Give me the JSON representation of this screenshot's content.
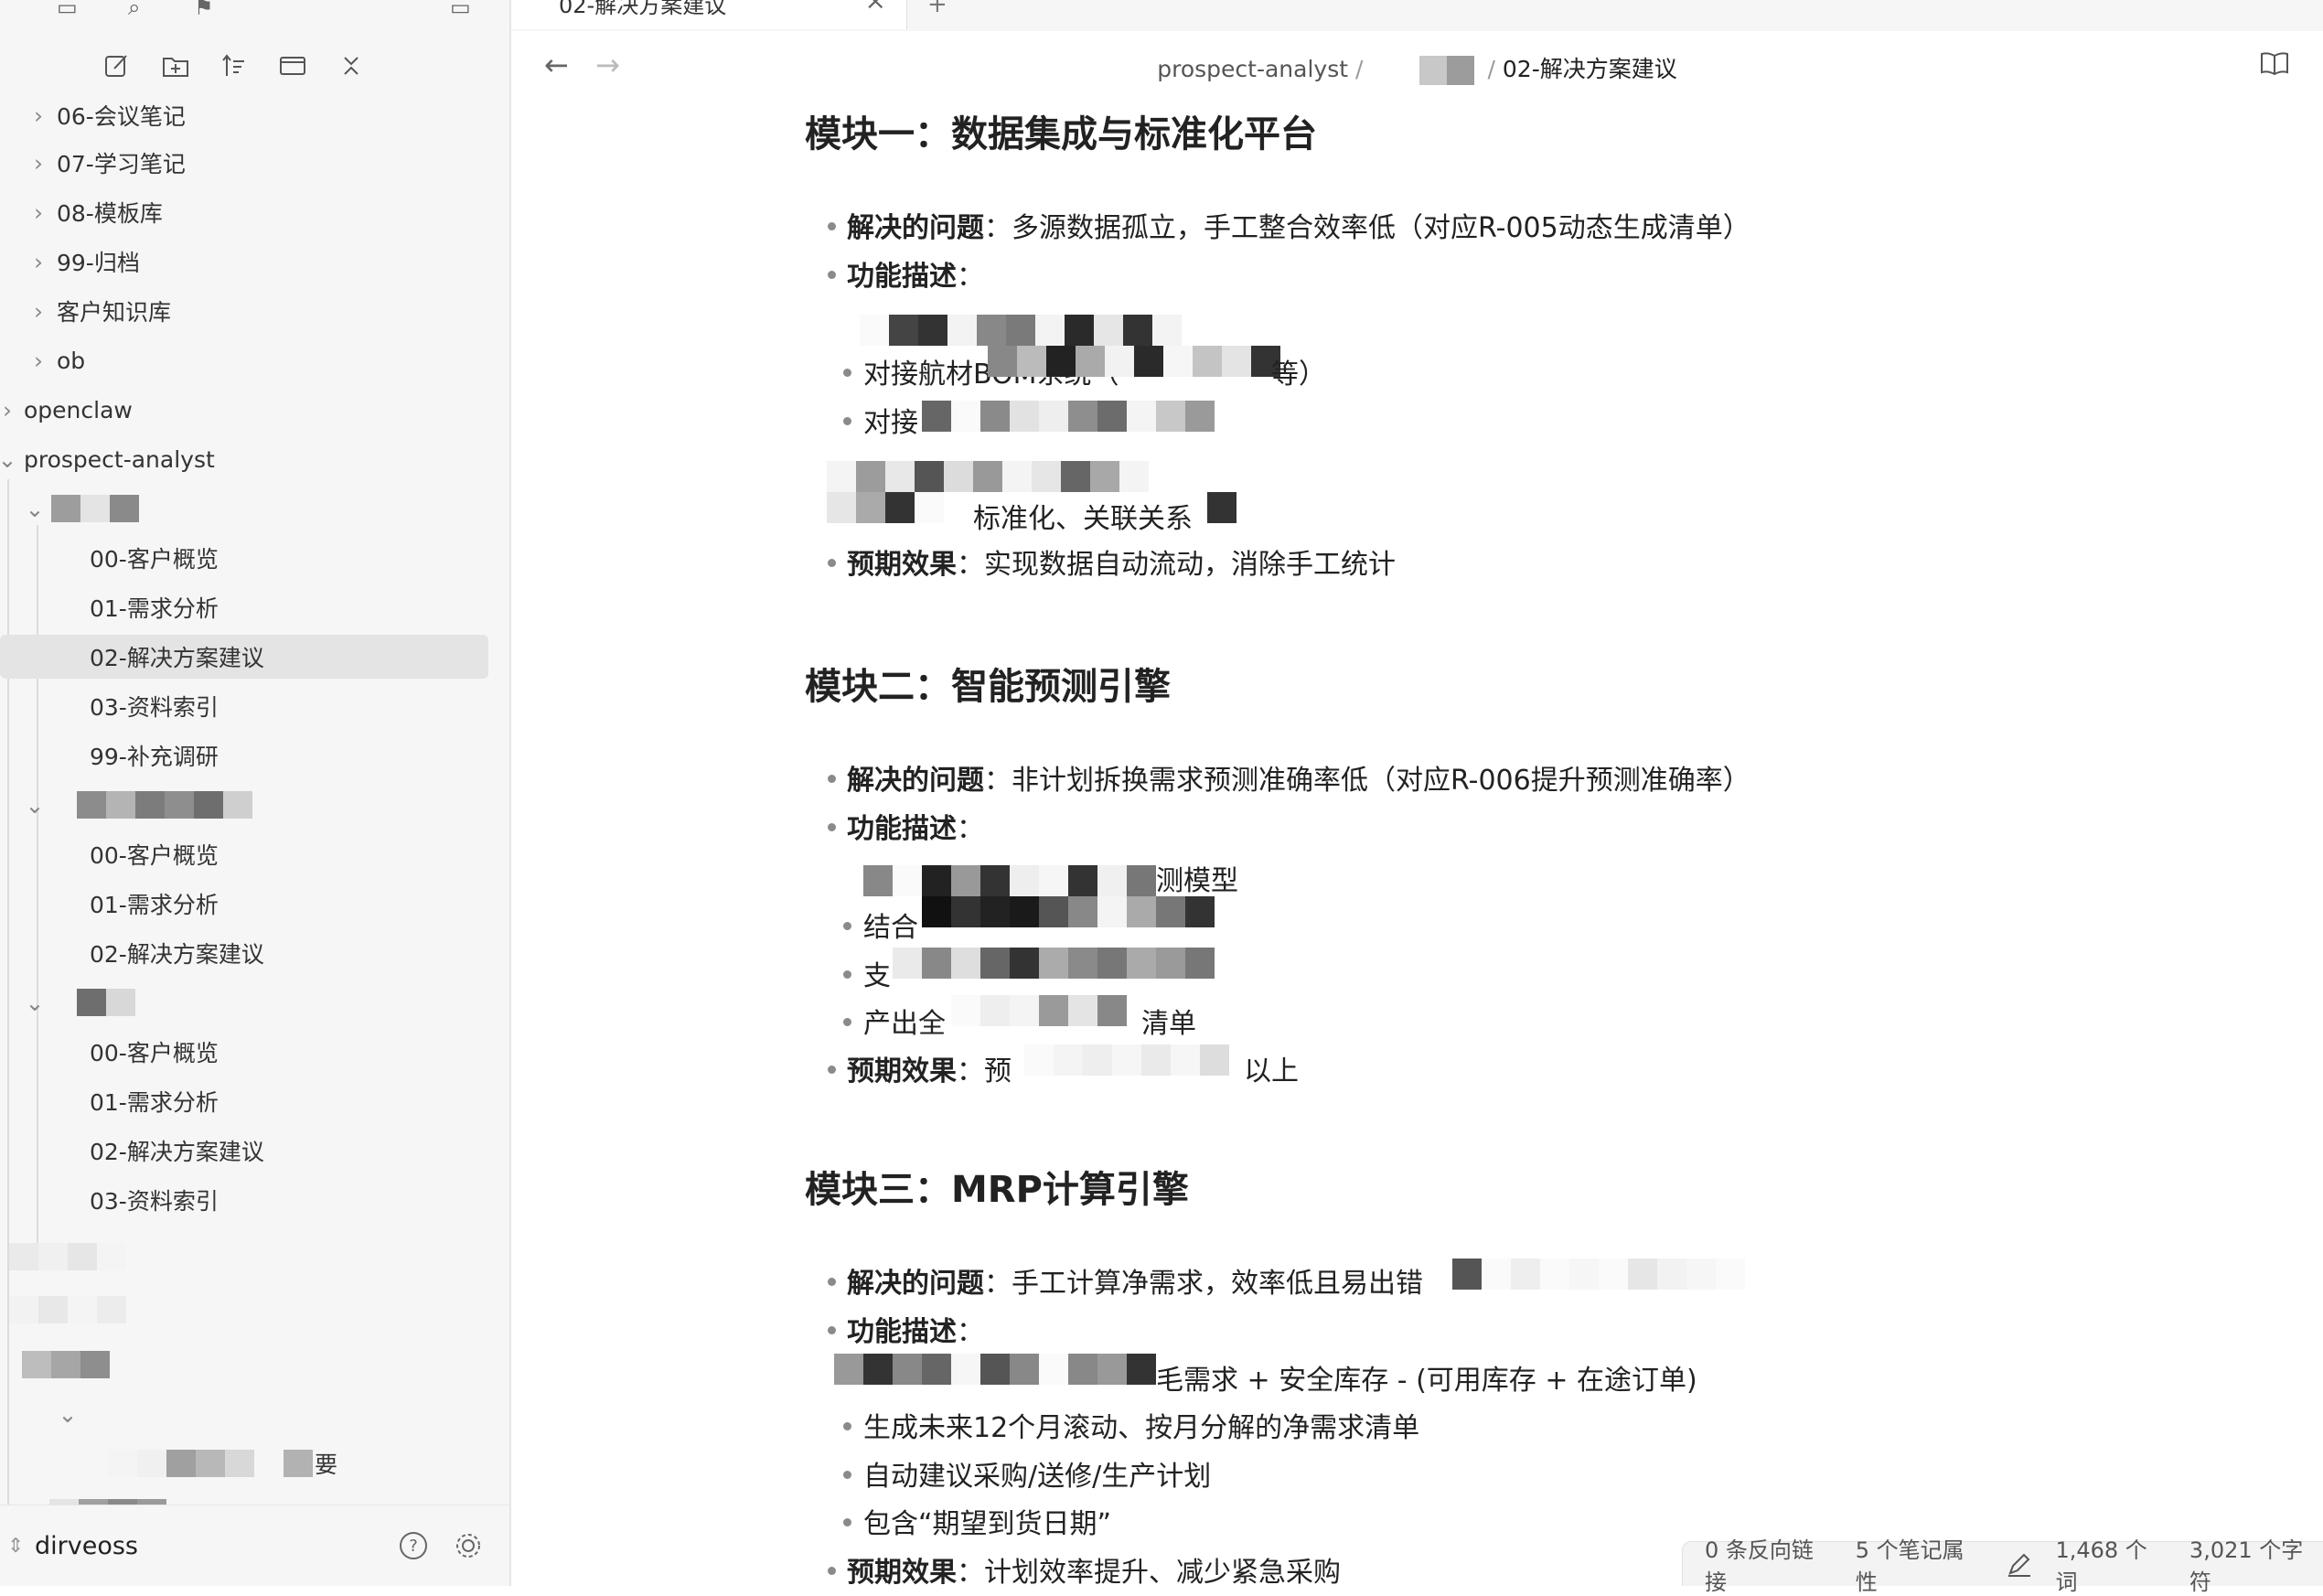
{
  "sidebar": {
    "toolbar": [
      "new-note-icon",
      "new-folder-icon",
      "sort-icon",
      "collapse-view-icon",
      "collapse-all-icon"
    ],
    "tree": [
      {
        "label": "06-会议笔记",
        "type": "folder",
        "collapsed": true
      },
      {
        "label": "07-学习笔记",
        "type": "folder",
        "collapsed": true
      },
      {
        "label": "08-模板库",
        "type": "folder",
        "collapsed": true
      },
      {
        "label": "99-归档",
        "type": "folder",
        "collapsed": true
      },
      {
        "label": "客户知识库",
        "type": "folder",
        "collapsed": true
      },
      {
        "label": "ob",
        "type": "folder",
        "collapsed": true
      },
      {
        "label": "openclaw",
        "type": "folder",
        "collapsed": true
      },
      {
        "label": "prospect-analyst",
        "type": "folder",
        "collapsed": false
      }
    ],
    "group1": {
      "files": [
        "00-客户概览",
        "01-需求分析",
        "02-解决方案建议",
        "03-资料索引",
        "99-补充调研"
      ]
    },
    "group2": {
      "files": [
        "00-客户概览",
        "01-需求分析",
        "02-解决方案建议"
      ]
    },
    "group3": {
      "files": [
        "00-客户概览",
        "01-需求分析",
        "02-解决方案建议",
        "03-资料索引"
      ]
    },
    "partial_label": "要",
    "vault": "dirveoss"
  },
  "tab": {
    "title": "02-解决方案建议"
  },
  "breadcrumb": {
    "root": "prospect-analyst",
    "current": "02-解决方案建议"
  },
  "content": {
    "module1": {
      "title": "模块一：数据集成与标准化平台",
      "problem_label": "解决的问题",
      "problem": "：多源数据孤立，手工整合效率低（对应R-005动态生成清单）",
      "func_label": "功能描述",
      "func_colon": "：",
      "sub1": "对接航材BOM系统（",
      "sub1_tail": "等）",
      "sub2": "对接",
      "sub3": "标准化、关联关系",
      "effect_label": "预期效果",
      "effect": "：实现数据自动流动，消除手工统计"
    },
    "module2": {
      "title": "模块二：智能预测引擎",
      "problem_label": "解决的问题",
      "problem": "：非计划拆换需求预测准确率低（对应R-006提升预测准确率）",
      "func_label": "功能描述",
      "func_colon": "：",
      "sub1_tail": "测模型",
      "sub2": "结合",
      "sub3": "支",
      "sub4": "产出全",
      "sub4_tail": "清单",
      "effect_label": "预期效果",
      "effect": "：预",
      "effect_tail": "以上"
    },
    "module3": {
      "title": "模块三：MRP计算引擎",
      "problem_label": "解决的问题",
      "problem": "：手工计算净需求，效率低且易出错",
      "func_label": "功能描述",
      "func_colon": "：",
      "sub1_tail": "毛需求 + 安全库存 - (可用库存 + 在途订单)",
      "sub2": "生成未来12个月滚动、按月分解的净需求清单",
      "sub3": "自动建议采购/送修/生产计划",
      "sub4": "包含“期望到货日期”",
      "effect_label": "预期效果",
      "effect": "：计划效率提升、减少紧急采购"
    }
  },
  "status": {
    "backlinks": "0 条反向链接",
    "properties": "5 个笔记属性",
    "words": "1,468 个词",
    "chars": "3,021 个字符"
  }
}
